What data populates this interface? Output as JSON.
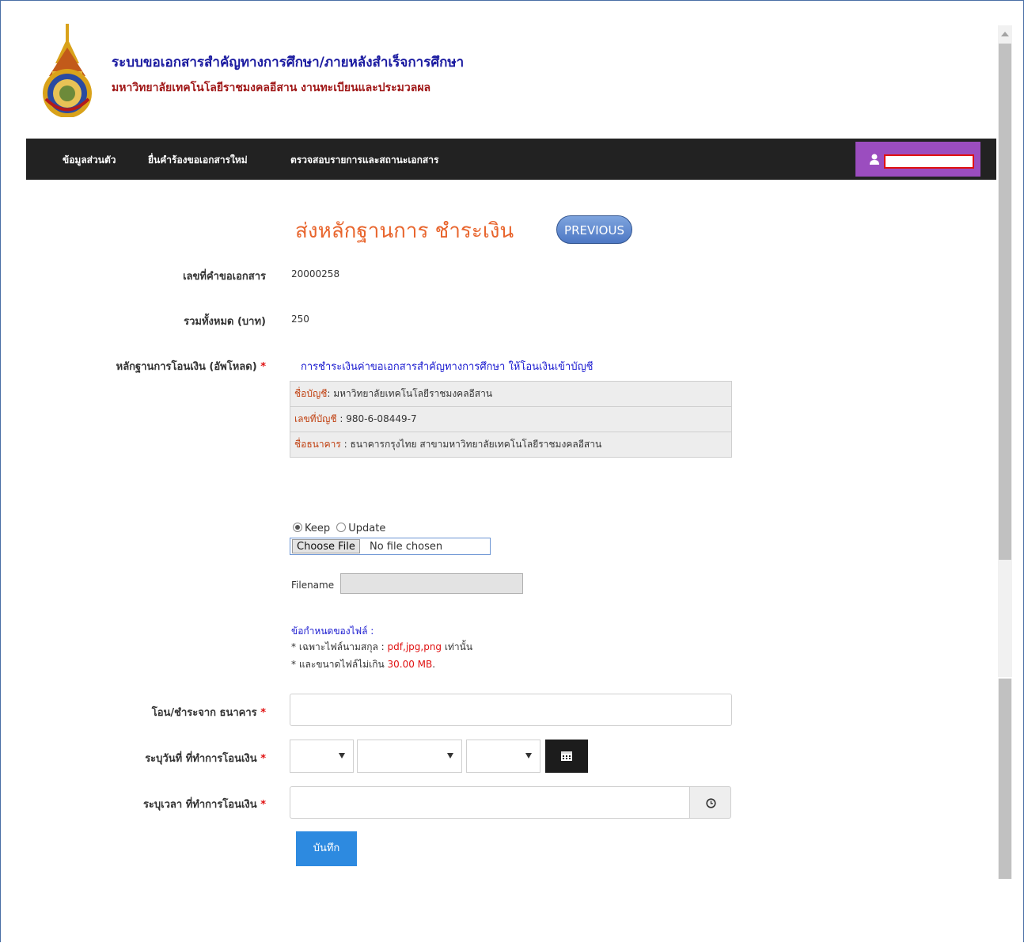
{
  "header": {
    "title": "ระบบขอเอกสารสำคัญทางการศึกษา/ภายหลังสำเร็จการศึกษา",
    "subtitle": "มหาวิทยาลัยเทคโนโลยีราชมงคลอีสาน งานทะเบียนและประมวลผล"
  },
  "nav": {
    "items": [
      "ข้อมูลส่วนตัว",
      "ยื่นคำร้องขอเอกสารใหม่",
      "ตรวจสอบรายการและสถานะเอกสาร"
    ],
    "user_name": ""
  },
  "page": {
    "title": "ส่งหลักฐานการ ชำระเงิน",
    "previous_label": "PREVIOUS"
  },
  "form": {
    "doc_no_label": "เลขที่คำขอเอกสาร",
    "doc_no_value": "20000258",
    "total_label": "รวมทั้งหมด (บาท)",
    "total_value": "250",
    "proof_label": "หลักฐานการโอนเงิน (อัพโหลด)",
    "required_mark": "*",
    "transfer_note": "การชำระเงินค่าขอเอกสารสำคัญทางการศึกษา  ให้โอนเงินเข้าบัญชี",
    "bank": {
      "account_name_key": "ชื่อบัญชี",
      "account_name": ": มหาวิทยาลัยเทคโนโลยีราชมงคลอีสาน",
      "account_no_key": "เลขที่บัญชี",
      "account_no": " : 980-6-08449-7",
      "bank_name_key": "ชื่อธนาคาร",
      "bank_name": " : ธนาคารกรุงไทย สาขามหาวิทยาลัยเทคโนโลยีราชมงคลอีสาน"
    },
    "radio_keep": "Keep",
    "radio_update": "Update",
    "choose_file": "Choose File",
    "no_file": "No file chosen",
    "filename_label": "Filename",
    "rules_title": "ข้อกำหนดของไฟล์ :",
    "rule1_prefix": "* เฉพาะไฟล์นามสกุล : ",
    "rule1_types": "pdf,jpg,png",
    "rule1_suffix": " เท่านั้น",
    "rule2_prefix": "* และขนาดไฟล์ไม่เกิน ",
    "rule2_size": "30.00 MB",
    "rule2_suffix": ".",
    "bank_from_label": "โอน/ชำระจาก ธนาคาร",
    "date_label": "ระบุวันที่ ที่ทำการโอนเงิน",
    "time_label": "ระบุเวลา ที่ทำการโอนเงิน",
    "save_label": "บันทึก"
  },
  "colors": {
    "navbar": "#222222",
    "user_box": "#9b4dbf",
    "page_title": "#e8652d",
    "save_button": "#2d8ae0"
  }
}
